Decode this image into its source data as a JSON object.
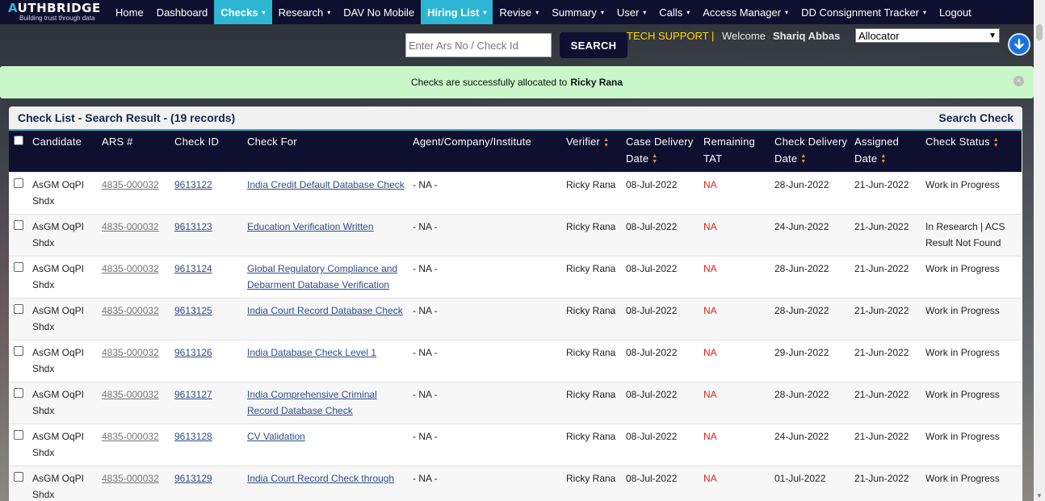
{
  "brand": {
    "name_first": "A",
    "name_rest": "UTHBRIDGE",
    "tagline": "Building trust through data"
  },
  "nav": [
    {
      "label": "Home",
      "dropdown": false,
      "active": false
    },
    {
      "label": "Dashboard",
      "dropdown": false,
      "active": false
    },
    {
      "label": "Checks",
      "dropdown": true,
      "active": true
    },
    {
      "label": "Research",
      "dropdown": true,
      "active": false
    },
    {
      "label": "DAV No Mobile",
      "dropdown": false,
      "active": false
    },
    {
      "label": "Hiring List",
      "dropdown": true,
      "active": true
    },
    {
      "label": "Revise",
      "dropdown": true,
      "active": false
    },
    {
      "label": "Summary",
      "dropdown": true,
      "active": false
    },
    {
      "label": "User",
      "dropdown": true,
      "active": false
    },
    {
      "label": "Calls",
      "dropdown": true,
      "active": false
    },
    {
      "label": "Access Manager",
      "dropdown": true,
      "active": false
    },
    {
      "label": "DD Consignment Tracker",
      "dropdown": true,
      "active": false
    },
    {
      "label": "Logout",
      "dropdown": false,
      "active": false
    }
  ],
  "search": {
    "placeholder": "Enter Ars No / Check Id",
    "value": "",
    "button_label": "SEARCH"
  },
  "header_info": {
    "tech_support": "TECH SUPPORT |",
    "welcome": "Welcome",
    "user_name": "Shariq Abbas",
    "role_selected": "Allocator"
  },
  "alert": {
    "message": "Checks are successfully allocated to",
    "name": "Ricky Rana"
  },
  "panel": {
    "title": "Check List - Search Result - (19 records)",
    "search_link": "Search Check"
  },
  "columns": [
    {
      "label": "Candidate",
      "sortable": false
    },
    {
      "label": "ARS #",
      "sortable": false
    },
    {
      "label": "Check ID",
      "sortable": false
    },
    {
      "label": "Check For",
      "sortable": false
    },
    {
      "label": "Agent/Company/Institute",
      "sortable": false
    },
    {
      "label": "Verifier",
      "sortable": true
    },
    {
      "label": "Case Delivery Date",
      "sortable": true
    },
    {
      "label": "Remaining TAT",
      "sortable": false
    },
    {
      "label": "Check Delivery Date",
      "sortable": true
    },
    {
      "label": "Assigned Date",
      "sortable": true
    },
    {
      "label": "Check Status",
      "sortable": true
    }
  ],
  "rows": [
    {
      "candidate": "AsGM OqPI Shdx",
      "ars": "4835-000032",
      "check_id": "9613122",
      "check_for": "India Credit Default Database Check",
      "agent": "- NA -",
      "verifier": "Ricky Rana",
      "case_delivery": "08-Jul-2022",
      "tat": "NA",
      "check_delivery": "28-Jun-2022",
      "assigned": "21-Jun-2022",
      "status": "Work in Progress"
    },
    {
      "candidate": "AsGM OqPI Shdx",
      "ars": "4835-000032",
      "check_id": "9613123",
      "check_for": "Education Verification Written",
      "agent": "- NA -",
      "verifier": "Ricky Rana",
      "case_delivery": "08-Jul-2022",
      "tat": "NA",
      "check_delivery": "24-Jun-2022",
      "assigned": "21-Jun-2022",
      "status": "In Research | ACS Result Not Found"
    },
    {
      "candidate": "AsGM OqPI Shdx",
      "ars": "4835-000032",
      "check_id": "9613124",
      "check_for": "Global Regulatory Compliance and Debarment Database Verification",
      "agent": "- NA -",
      "verifier": "Ricky Rana",
      "case_delivery": "08-Jul-2022",
      "tat": "NA",
      "check_delivery": "28-Jun-2022",
      "assigned": "21-Jun-2022",
      "status": "Work in Progress"
    },
    {
      "candidate": "AsGM OqPI Shdx",
      "ars": "4835-000032",
      "check_id": "9613125",
      "check_for": "India Court Record Database Check",
      "agent": "- NA -",
      "verifier": "Ricky Rana",
      "case_delivery": "08-Jul-2022",
      "tat": "NA",
      "check_delivery": "28-Jun-2022",
      "assigned": "21-Jun-2022",
      "status": "Work in Progress"
    },
    {
      "candidate": "AsGM OqPI Shdx",
      "ars": "4835-000032",
      "check_id": "9613126",
      "check_for": "India Database Check Level 1",
      "agent": "- NA -",
      "verifier": "Ricky Rana",
      "case_delivery": "08-Jul-2022",
      "tat": "NA",
      "check_delivery": "29-Jun-2022",
      "assigned": "21-Jun-2022",
      "status": "Work in Progress"
    },
    {
      "candidate": "AsGM OqPI Shdx",
      "ars": "4835-000032",
      "check_id": "9613127",
      "check_for": "India Comprehensive Criminal Record Database Check",
      "agent": "- NA -",
      "verifier": "Ricky Rana",
      "case_delivery": "08-Jul-2022",
      "tat": "NA",
      "check_delivery": "28-Jun-2022",
      "assigned": "21-Jun-2022",
      "status": "Work in Progress"
    },
    {
      "candidate": "AsGM OqPI Shdx",
      "ars": "4835-000032",
      "check_id": "9613128",
      "check_for": "CV Validation",
      "agent": "- NA -",
      "verifier": "Ricky Rana",
      "case_delivery": "08-Jul-2022",
      "tat": "NA",
      "check_delivery": "24-Jun-2022",
      "assigned": "21-Jun-2022",
      "status": "Work in Progress"
    },
    {
      "candidate": "AsGM OqPI Shdx",
      "ars": "4835-000032",
      "check_id": "9613129",
      "check_for": "India Court Record Check through",
      "agent": "- NA -",
      "verifier": "Ricky Rana",
      "case_delivery": "08-Jul-2022",
      "tat": "NA",
      "check_delivery": "01-Jul-2022",
      "assigned": "21-Jun-2022",
      "status": "Work in Progress"
    }
  ],
  "colors": {
    "nav_bg": "#0f0f2f",
    "accent": "#2cb6d3",
    "alert_bg": "#c9f7c9",
    "sort_icon": "#f7941d",
    "tat_na": "#e2231a"
  }
}
